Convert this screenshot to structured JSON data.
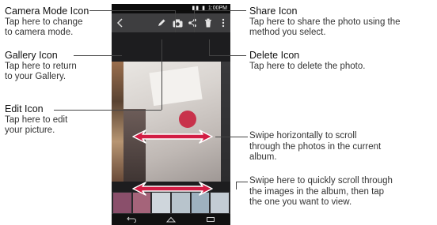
{
  "callouts": {
    "camera_mode": {
      "title": "Camera Mode Icon",
      "desc_lines": [
        "Tap here to change",
        "to camera mode."
      ]
    },
    "gallery": {
      "title": "Gallery Icon",
      "desc_lines": [
        "Tap here to return",
        "to your Gallery."
      ]
    },
    "edit": {
      "title": "Edit Icon",
      "desc_lines": [
        "Tap here to edit",
        "your picture."
      ]
    },
    "share": {
      "title": "Share Icon",
      "desc_lines": [
        "Tap here to share the photo using the",
        "method you select."
      ]
    },
    "delete": {
      "title": "Delete Icon",
      "desc_lines": [
        "Tap here to delete the photo."
      ]
    },
    "swipe_photos": {
      "desc_lines": [
        "Swipe horizontally to scroll",
        "through the photos in the current",
        "album."
      ]
    },
    "swipe_thumbs": {
      "desc_lines": [
        "Swipe here to quickly scroll through",
        "the images in the album, then tap",
        "the one you want to view."
      ]
    }
  },
  "phone": {
    "status_time": "1:00PM",
    "icons": {
      "back": "chevron-left-icon",
      "edit": "pencil-icon",
      "camera": "camera-icon",
      "share": "share-icon",
      "delete": "trash-icon",
      "menu": "more-vertical-icon"
    },
    "nav": [
      "back-icon",
      "home-icon",
      "recent-apps-icon"
    ]
  },
  "colors": {
    "arrow": "#d21d44",
    "actionbar": "#3e3e40",
    "line": "#444444"
  }
}
